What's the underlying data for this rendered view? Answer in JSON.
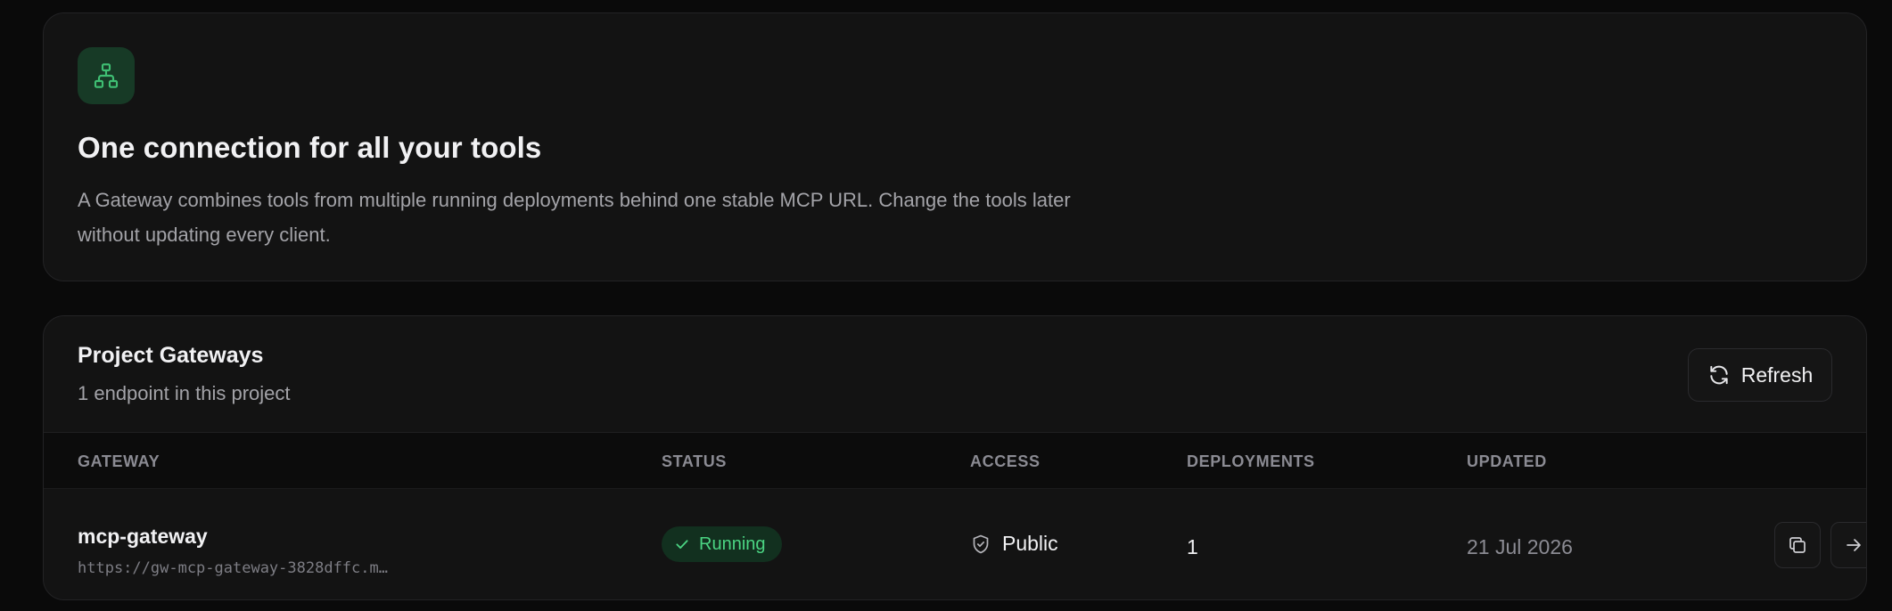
{
  "intro": {
    "icon": "sitemap-icon",
    "title": "One connection for all your tools",
    "description": "A Gateway combines tools from multiple running deployments behind one stable MCP URL. Change the tools later without updating every client."
  },
  "gateways": {
    "title": "Project Gateways",
    "subtitle": "1 endpoint in this project",
    "refresh_label": "Refresh",
    "columns": [
      "GATEWAY",
      "STATUS",
      "ACCESS",
      "DEPLOYMENTS",
      "UPDATED"
    ],
    "rows": [
      {
        "name": "mcp-gateway",
        "url": "https://gw-mcp-gateway-3828dffc.m…",
        "status": "Running",
        "access": "Public",
        "deployments": "1",
        "updated": "21 Jul 2026"
      }
    ]
  },
  "colors": {
    "accent": "#4bd583",
    "background": "#0a0a0a",
    "card": "#131313"
  }
}
